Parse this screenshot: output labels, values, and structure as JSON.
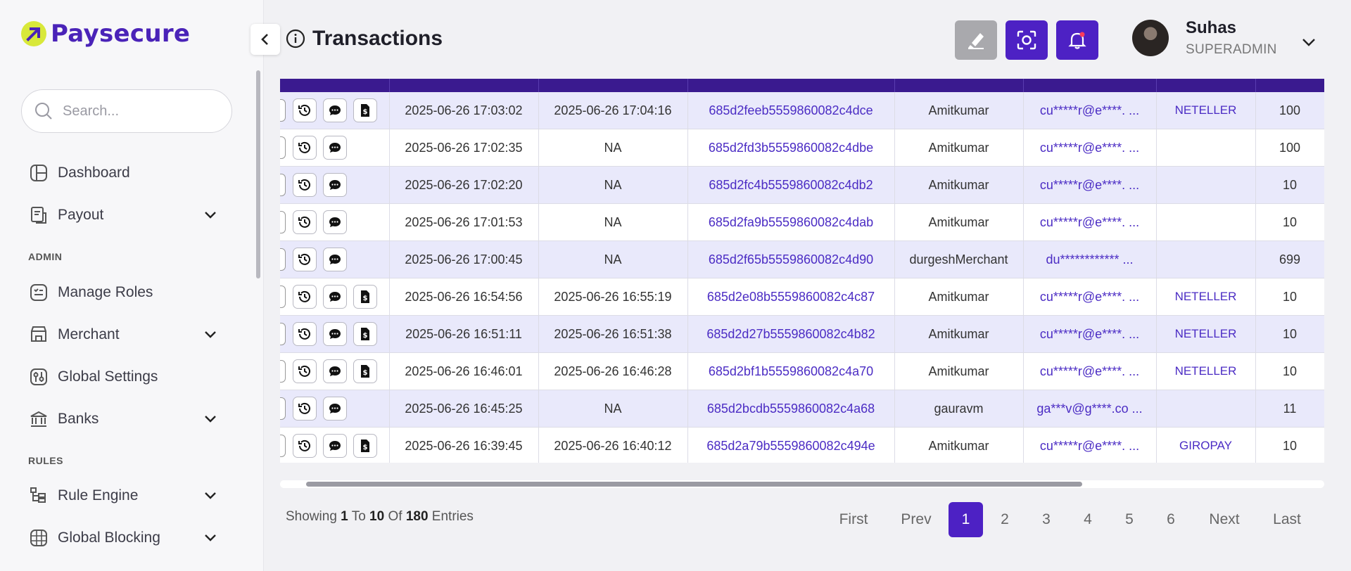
{
  "brand": {
    "name": "Paysecure"
  },
  "search": {
    "placeholder": "Search..."
  },
  "sidebar": {
    "items": [
      {
        "label": "Dashboard"
      },
      {
        "label": "Payout"
      },
      {
        "label": "Manage Roles"
      },
      {
        "label": "Merchant"
      },
      {
        "label": "Global Settings"
      },
      {
        "label": "Banks"
      },
      {
        "label": "Rule Engine"
      },
      {
        "label": "Global Blocking"
      }
    ],
    "sections": {
      "admin": "ADMIN",
      "rules": "RULES"
    }
  },
  "header": {
    "title": "Transactions",
    "user": {
      "name": "Suhas",
      "role": "SUPERADMIN"
    }
  },
  "table": {
    "rows": [
      {
        "created": "2025-06-26 17:03:02",
        "updated": "2025-06-26 17:04:16",
        "id": "685d2feeb5559860082c4dce",
        "merchant": "Amitkumar",
        "email": "cu*****r@e****. ...",
        "method": "NETELLER",
        "amount": "100",
        "receipt": true
      },
      {
        "created": "2025-06-26 17:02:35",
        "updated": "NA",
        "id": "685d2fd3b5559860082c4dbe",
        "merchant": "Amitkumar",
        "email": "cu*****r@e****. ...",
        "method": "",
        "amount": "100",
        "receipt": false
      },
      {
        "created": "2025-06-26 17:02:20",
        "updated": "NA",
        "id": "685d2fc4b5559860082c4db2",
        "merchant": "Amitkumar",
        "email": "cu*****r@e****. ...",
        "method": "",
        "amount": "10",
        "receipt": false
      },
      {
        "created": "2025-06-26 17:01:53",
        "updated": "NA",
        "id": "685d2fa9b5559860082c4dab",
        "merchant": "Amitkumar",
        "email": "cu*****r@e****. ...",
        "method": "",
        "amount": "10",
        "receipt": false
      },
      {
        "created": "2025-06-26 17:00:45",
        "updated": "NA",
        "id": "685d2f65b5559860082c4d90",
        "merchant": "durgeshMerchant",
        "email": "du************ ...",
        "method": "",
        "amount": "699",
        "receipt": false
      },
      {
        "created": "2025-06-26 16:54:56",
        "updated": "2025-06-26 16:55:19",
        "id": "685d2e08b5559860082c4c87",
        "merchant": "Amitkumar",
        "email": "cu*****r@e****. ...",
        "method": "NETELLER",
        "amount": "10",
        "receipt": true
      },
      {
        "created": "2025-06-26 16:51:11",
        "updated": "2025-06-26 16:51:38",
        "id": "685d2d27b5559860082c4b82",
        "merchant": "Amitkumar",
        "email": "cu*****r@e****. ...",
        "method": "NETELLER",
        "amount": "10",
        "receipt": true
      },
      {
        "created": "2025-06-26 16:46:01",
        "updated": "2025-06-26 16:46:28",
        "id": "685d2bf1b5559860082c4a70",
        "merchant": "Amitkumar",
        "email": "cu*****r@e****. ...",
        "method": "NETELLER",
        "amount": "10",
        "receipt": true
      },
      {
        "created": "2025-06-26 16:45:25",
        "updated": "NA",
        "id": "685d2bcdb5559860082c4a68",
        "merchant": "gauravm",
        "email": "ga***v@g****.co ...",
        "method": "",
        "amount": "11",
        "receipt": false
      },
      {
        "created": "2025-06-26 16:39:45",
        "updated": "2025-06-26 16:40:12",
        "id": "685d2a79b5559860082c494e",
        "merchant": "Amitkumar",
        "email": "cu*****r@e****. ...",
        "method": "GIROPAY",
        "amount": "10",
        "receipt": true
      }
    ]
  },
  "footer": {
    "showing_prefix": "Showing",
    "from": "1",
    "to_label": "To",
    "to": "10",
    "of_label": "Of",
    "total": "180",
    "suffix": "Entries"
  },
  "pagination": {
    "first": "First",
    "prev": "Prev",
    "pages": [
      "1",
      "2",
      "3",
      "4",
      "5",
      "6"
    ],
    "active_page": "1",
    "next": "Next",
    "last": "Last"
  },
  "colors": {
    "accent": "#4d21c4",
    "header_row": "#3a1a8f",
    "row_alt": "#e9e9fb",
    "logo_dot": "#d8e83a"
  },
  "icons": [
    "history-icon",
    "comment-icon",
    "receipt-icon",
    "scan-icon",
    "bell-icon",
    "eraser-icon",
    "info-icon",
    "search-icon"
  ]
}
